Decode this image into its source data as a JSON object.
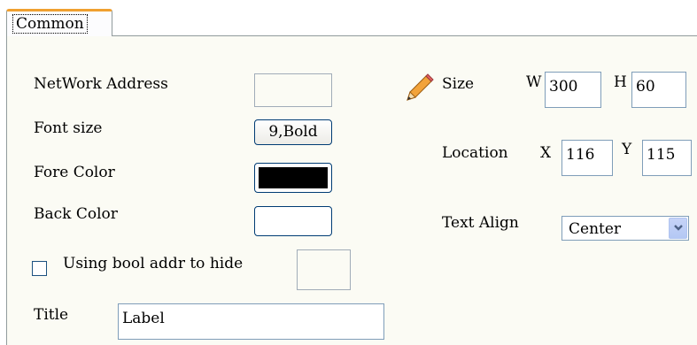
{
  "tab": {
    "label": "Common"
  },
  "network_address": {
    "label": "NetWork Address",
    "value": ""
  },
  "font_size": {
    "label": "Font size",
    "button_label": "9,Bold"
  },
  "fore_color": {
    "label": "Fore Color",
    "color": "#000000"
  },
  "back_color": {
    "label": "Back Color",
    "color": "#ffffff"
  },
  "bool_hide": {
    "label": "Using bool addr to hide",
    "checked": false,
    "addr_value": ""
  },
  "title": {
    "label": "Title",
    "value": "Label"
  },
  "size": {
    "label": "Size",
    "icon": "pencil-icon",
    "w_label": "W",
    "w_value": "300",
    "h_label": "H",
    "h_value": "60"
  },
  "location": {
    "label": "Location",
    "x_label": "X",
    "x_value": "116",
    "y_label": "Y",
    "y_value": "115"
  },
  "text_align": {
    "label": "Text Align",
    "selected": "Center"
  },
  "colors": {
    "tab_accent": "#f0a030",
    "panel_bg": "#fbfbf4",
    "input_border": "#7f9db9",
    "button_border": "#003c74"
  }
}
